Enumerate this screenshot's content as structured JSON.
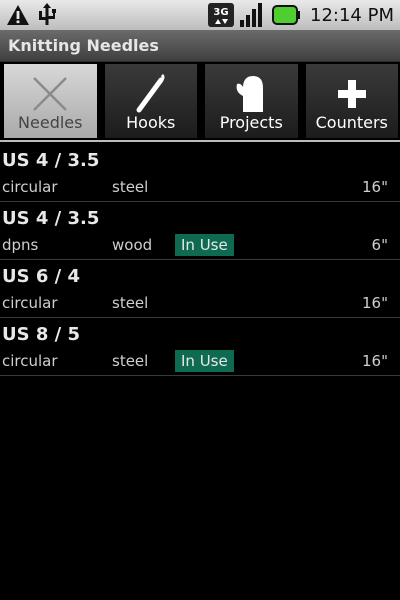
{
  "status_bar": {
    "time": "12:14 PM",
    "network_label": "3G",
    "icons": [
      "warning-icon",
      "usb-icon",
      "3g-icon",
      "signal-icon",
      "battery-icon"
    ]
  },
  "title": "Knitting Needles",
  "tabs": [
    {
      "label": "Needles",
      "icon": "close-icon",
      "selected": true
    },
    {
      "label": "Hooks",
      "icon": "hook-icon",
      "selected": false
    },
    {
      "label": "Projects",
      "icon": "mitten-icon",
      "selected": false
    },
    {
      "label": "Counters",
      "icon": "plus-icon",
      "selected": false
    }
  ],
  "needles": [
    {
      "size": "US 4 / 3.5",
      "type": "circular",
      "material": "steel",
      "in_use": "",
      "length": "16\""
    },
    {
      "size": "US 4 / 3.5",
      "type": "dpns",
      "material": "wood",
      "in_use": "In Use",
      "length": "6\""
    },
    {
      "size": "US 6 / 4",
      "type": "circular",
      "material": "steel",
      "in_use": "",
      "length": "16\""
    },
    {
      "size": "US 8 / 5",
      "type": "circular",
      "material": "steel",
      "in_use": "In Use",
      "length": "16\""
    }
  ],
  "colors": {
    "badge": "#0e6b52",
    "battery": "#4fcf2f",
    "background": "#000000"
  }
}
